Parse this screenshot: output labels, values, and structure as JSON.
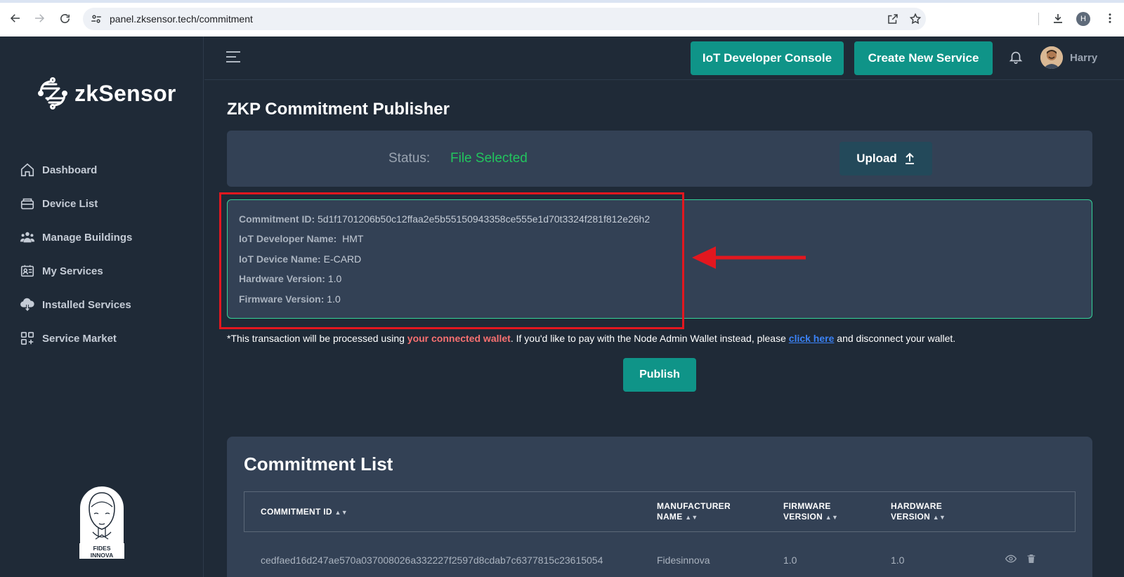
{
  "browser": {
    "url": "panel.zksensor.tech/commitment",
    "profile_initial": "H"
  },
  "brand": {
    "name": "zkSensor"
  },
  "sidebar": {
    "items": [
      {
        "label": "Dashboard",
        "icon": "home-icon"
      },
      {
        "label": "Device List",
        "icon": "device-icon"
      },
      {
        "label": "Manage Buildings",
        "icon": "people-icon"
      },
      {
        "label": "My Services",
        "icon": "id-card-icon"
      },
      {
        "label": "Installed Services",
        "icon": "cloud-download-icon"
      },
      {
        "label": "Service Market",
        "icon": "grid-plus-icon"
      }
    ],
    "footer_logo": {
      "line1": "FIDES",
      "line2": "INNOVA"
    }
  },
  "header": {
    "console_button": "IoT Developer Console",
    "create_button": "Create New Service",
    "user_name": "Harry"
  },
  "publisher": {
    "title": "ZKP Commitment Publisher",
    "status_label": "Status:",
    "status_value": "File Selected",
    "upload_label": "Upload",
    "details": {
      "commitment_id_label": "Commitment ID:",
      "commitment_id": "5d1f1701206b50c12ffaa2e5b55150943358ce555e1d70t3324f281f812e26h2",
      "developer_label": "IoT Developer Name:",
      "developer": "HMT",
      "device_label": "IoT Device Name:",
      "device": "E-CARD",
      "hardware_label": "Hardware Version:",
      "hardware": "1.0",
      "firmware_label": "Firmware Version:",
      "firmware": "1.0"
    },
    "note": {
      "prefix": "*This transaction will be processed using ",
      "highlight": "your connected wallet",
      "middle": ". If you'd like to pay with the Node Admin Wallet instead, please ",
      "link": "click here",
      "suffix": " and disconnect your wallet."
    },
    "publish_label": "Publish"
  },
  "commitment_list": {
    "title": "Commitment List",
    "columns": {
      "id": "COMMITMENT ID",
      "manufacturer_1": "MANUFACTURER",
      "manufacturer_2": "NAME",
      "firmware_1": "FIRMWARE",
      "firmware_2": "VERSION",
      "hardware_1": "HARDWARE",
      "hardware_2": "VERSION"
    },
    "rows": [
      {
        "id": "cedfaed16d247ae570a037008026a332227f2597d8cdab7c6377815c23615054",
        "manufacturer": "Fidesinnova",
        "firmware": "1.0",
        "hardware": "1.0"
      }
    ]
  },
  "colors": {
    "accent": "#0f9488",
    "status_ok": "#22c55e",
    "annotation": "#e3171f"
  }
}
